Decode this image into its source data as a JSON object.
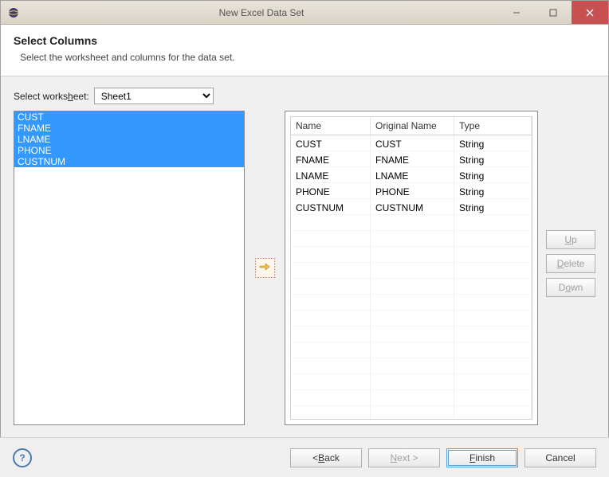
{
  "window": {
    "title": "New Excel Data Set"
  },
  "header": {
    "title": "Select Columns",
    "subtitle": "Select the worksheet and columns for the data set."
  },
  "worksheet": {
    "label_pre": "Select works",
    "label_u": "h",
    "label_post": "eet:",
    "selected": "Sheet1"
  },
  "source_columns": [
    "CUST",
    "FNAME",
    "LNAME",
    "PHONE",
    "CUSTNUM"
  ],
  "table": {
    "headers": {
      "name": "Name",
      "original": "Original Name",
      "type": "Type"
    },
    "rows": [
      {
        "name": "CUST",
        "original": "CUST",
        "type": "String"
      },
      {
        "name": "FNAME",
        "original": "FNAME",
        "type": "String"
      },
      {
        "name": "LNAME",
        "original": "LNAME",
        "type": "String"
      },
      {
        "name": "PHONE",
        "original": "PHONE",
        "type": "String"
      },
      {
        "name": "CUSTNUM",
        "original": "CUSTNUM",
        "type": "String"
      }
    ]
  },
  "sidebtns": {
    "up_u": "U",
    "up": "p",
    "delete_u": "D",
    "delete": "elete",
    "down": "D",
    "down_u": "o",
    "down_post": "wn"
  },
  "footer": {
    "back_pre": "< ",
    "back_u": "B",
    "back": "ack",
    "next_u": "N",
    "next": "ext >",
    "finish_u": "F",
    "finish": "inish",
    "cancel": "Cancel"
  }
}
